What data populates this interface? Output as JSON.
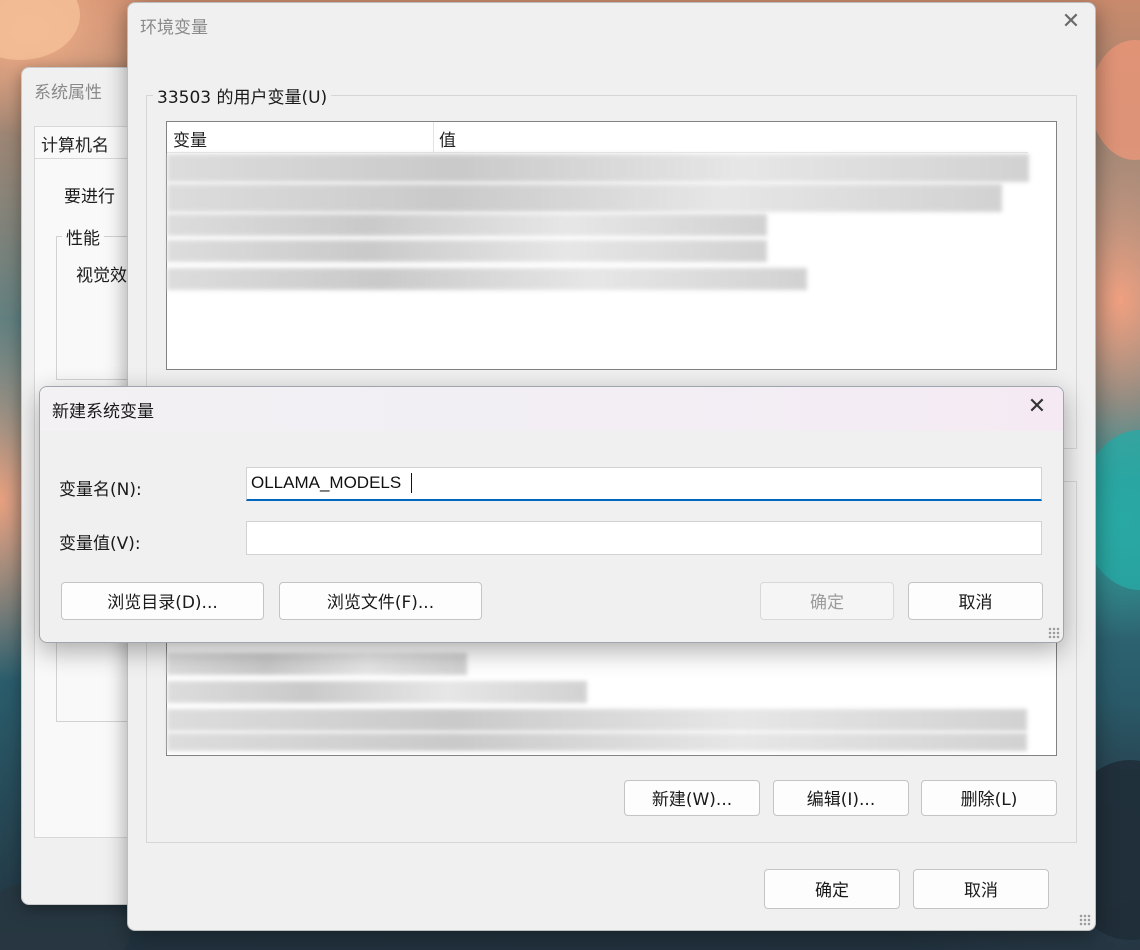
{
  "system_properties": {
    "title": "系统属性",
    "tab_label": "计算机名",
    "text_line": "要进行",
    "group_label": "性能",
    "group_text": "视觉效"
  },
  "env_window": {
    "title": "环境变量",
    "user_vars_label": "33503 的用户变量(U)",
    "columns": [
      "变量",
      "值"
    ],
    "system_buttons": {
      "new": "新建(W)...",
      "edit": "编辑(I)...",
      "delete": "删除(L)"
    },
    "ok": "确定",
    "cancel": "取消"
  },
  "new_var_dialog": {
    "title": "新建系统变量",
    "name_label": "变量名(N):",
    "value_label": "变量值(V):",
    "name_value": "OLLAMA_MODELS",
    "value_value": "",
    "browse_dir": "浏览目录(D)...",
    "browse_file": "浏览文件(F)...",
    "ok": "确定",
    "cancel": "取消"
  },
  "icons": {
    "close": "close-icon",
    "resize_grip": "resize-grip-icon"
  }
}
